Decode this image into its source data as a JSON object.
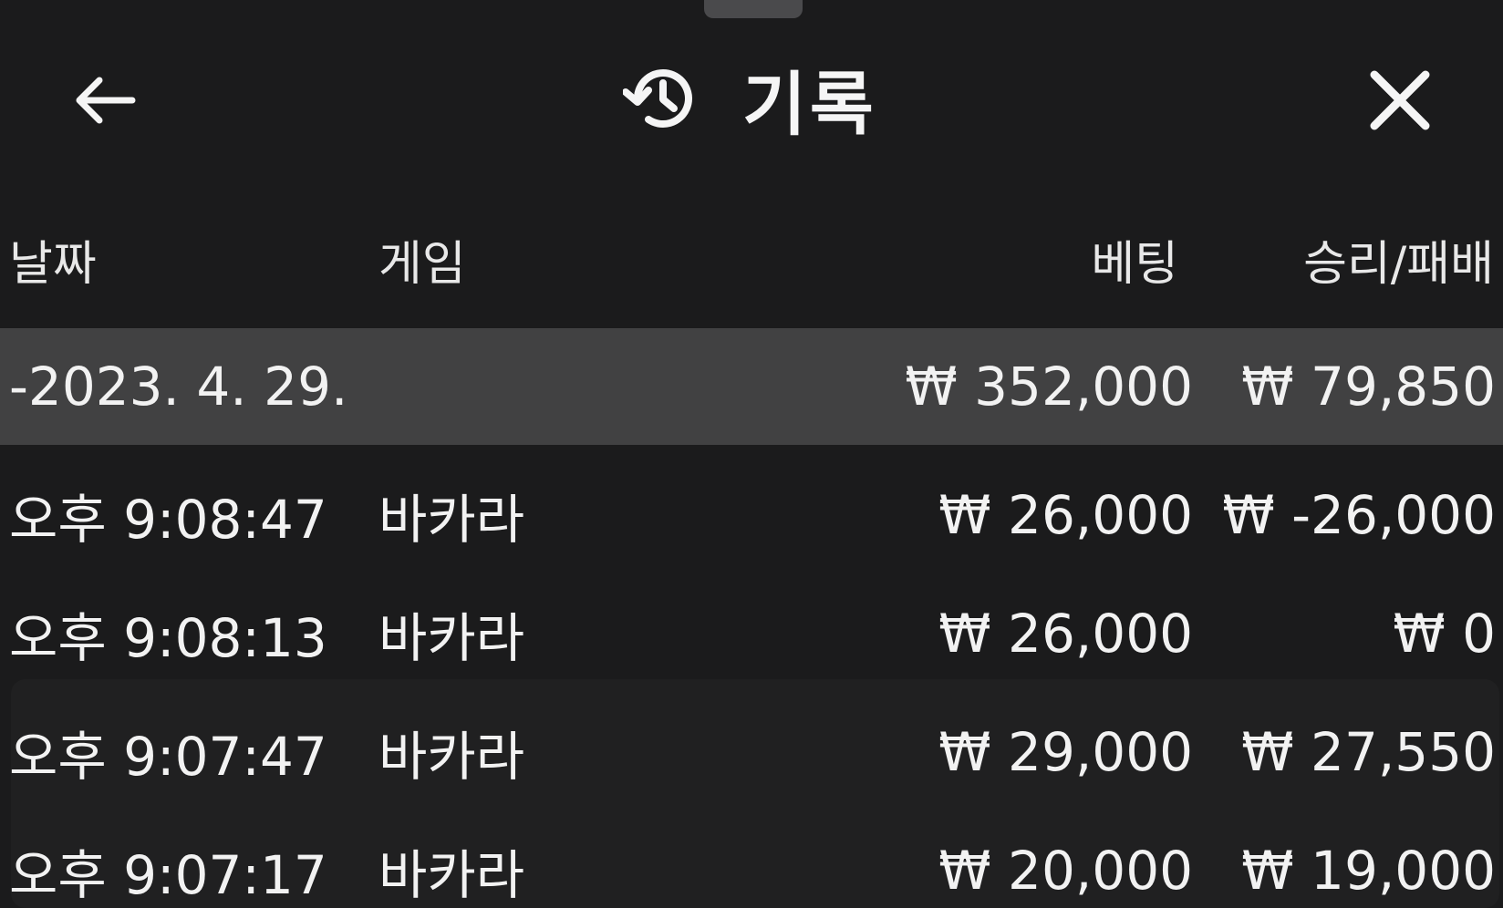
{
  "header": {
    "title": "기록",
    "back_icon": "arrow-left-icon",
    "history_icon": "history-clock-icon",
    "close_icon": "close-icon"
  },
  "columns": {
    "date": "날짜",
    "game": "게임",
    "bet": "베팅",
    "result": "승리/패배"
  },
  "summary": {
    "date": "-2023. 4. 29.",
    "bet": "₩ 352,000",
    "result": "₩ 79,850"
  },
  "rows": [
    {
      "time": "오후 9:08:47",
      "game": "바카라",
      "bet": "₩ 26,000",
      "result": "₩ -26,000"
    },
    {
      "time": "오후 9:08:13",
      "game": "바카라",
      "bet": "₩ 26,000",
      "result": "₩ 0"
    },
    {
      "time": "오후 9:07:47",
      "game": "바카라",
      "bet": "₩ 29,000",
      "result": "₩ 27,550"
    },
    {
      "time": "오후 9:07:17",
      "game": "바카라",
      "bet": "₩ 20,000",
      "result": "₩ 19,000"
    }
  ],
  "colors": {
    "background": "#1b1b1c",
    "summary_row": "#414142",
    "text": "#f2f2f2"
  }
}
